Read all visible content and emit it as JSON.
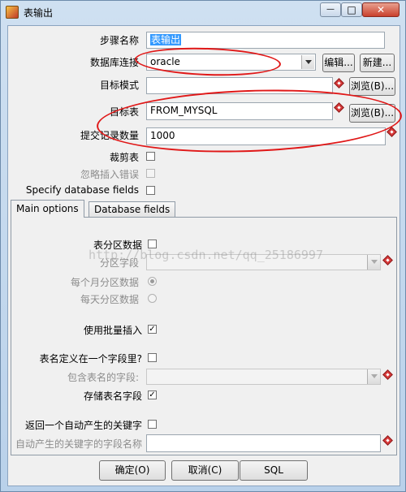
{
  "window": {
    "title": "表输出",
    "minimize_glyph": "—",
    "maximize_glyph": "□",
    "close_glyph": "✕"
  },
  "form": {
    "step_name_label": "步骤名称",
    "step_name_value": "表输出",
    "connection_label": "数据库连接",
    "connection_value": "oracle",
    "edit_button": "编辑...",
    "new_button": "新建...",
    "schema_label": "目标模式",
    "schema_value": "",
    "browse_button_1": "浏览(B)...",
    "table_label": "目标表",
    "table_value": "FROM_MYSQL",
    "browse_button_2": "浏览(B)...",
    "commit_label": "提交记录数量",
    "commit_value": "1000",
    "truncate_label": "裁剪表",
    "truncate_checked": false,
    "ignore_errors_label": "忽略插入错误",
    "ignore_errors_checked": false,
    "specify_fields_label": "Specify database fields",
    "specify_fields_checked": false
  },
  "tabs": [
    {
      "label": "Main options",
      "active": true
    },
    {
      "label": "Database fields",
      "active": false
    }
  ],
  "main_options": {
    "partition_label": "表分区数据",
    "partition_checked": false,
    "partition_field_label": "分区字段",
    "partition_field_value": "",
    "monthly_label": "每个月分区数据",
    "monthly_selected": true,
    "daily_label": "每天分区数据",
    "daily_selected": false,
    "batch_label": "使用批量插入",
    "batch_checked": true,
    "tablename_in_field_label": "表名定义在一个字段里?",
    "tablename_in_field_checked": false,
    "tablename_field_label": "包含表名的字段:",
    "tablename_field_value": "",
    "store_tablename_label": "存储表名字段",
    "store_tablename_checked": true,
    "return_key_label": "返回一个自动产生的关键字",
    "return_key_checked": false,
    "key_field_name_label": "自动产生的关键字的字段名称",
    "key_field_name_value": ""
  },
  "watermark": "http://blog.csdn.net/qq_25186997",
  "buttons": {
    "ok": "确定(O)",
    "cancel": "取消(C)",
    "sql": "SQL"
  },
  "check_glyph": "✓",
  "colors": {
    "annotation_red": "#e01818",
    "selection_blue": "#3399ff",
    "required_marker": "#d83a3a"
  },
  "icons": [
    "app-icon",
    "minimize-icon",
    "maximize-icon",
    "close-icon",
    "required-field-icon",
    "dropdown-arrow-icon"
  ]
}
